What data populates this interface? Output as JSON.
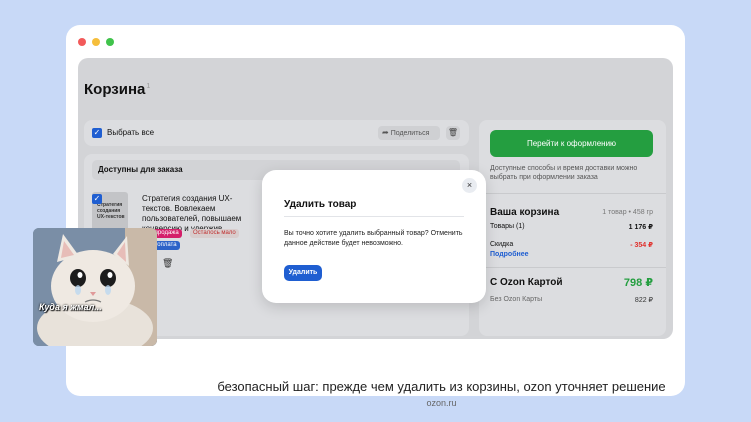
{
  "page": {
    "title": "Корзина",
    "title_count": "1"
  },
  "toolbar": {
    "select_all": "Выбрать все",
    "share": "Поделиться"
  },
  "available": {
    "heading": "Доступны для заказа",
    "product": {
      "name": "Стратегия создания UX-текстов. Вовлекаем пользователей, повышаем конверсию и удержив",
      "cover_text": "Стратегия создания UX-текстов",
      "tags": {
        "sale": "распродажа",
        "left": "Осталось мало",
        "pay": "постоплата"
      }
    }
  },
  "summary": {
    "checkout": "Перейти к оформлению",
    "delivery_note": "Доступные способы и время доставки можно выбрать при оформлении заказа",
    "cart_title": "Ваша корзина",
    "cart_count": "1 товар • 458 гр",
    "goods_label": "Товары (1)",
    "goods_value": "1 176 ₽",
    "discount_label": "Скидка",
    "discount_value": "- 354 ₽",
    "details": "Подробнее",
    "card_title": "С Ozon Картой",
    "card_price": "798 ₽",
    "nocard_label": "Без Ozon Карты",
    "nocard_value": "822 ₽"
  },
  "modal": {
    "title": "Удалить товар",
    "text": "Вы точно хотите удалить выбранный товар? Отменить данное действие будет невозможно.",
    "button": "Удалить",
    "close_icon": "×"
  },
  "caption": "безопасный шаг: прежде чем удалить из корзины, ozon уточняет решение",
  "source": "ozon.ru",
  "meme": {
    "caption": "Куда я жмал..."
  },
  "colors": {
    "accent": "#1f5ed1",
    "checkout": "#249e40",
    "discount": "#e0302c",
    "background": "#c8d9f7"
  }
}
